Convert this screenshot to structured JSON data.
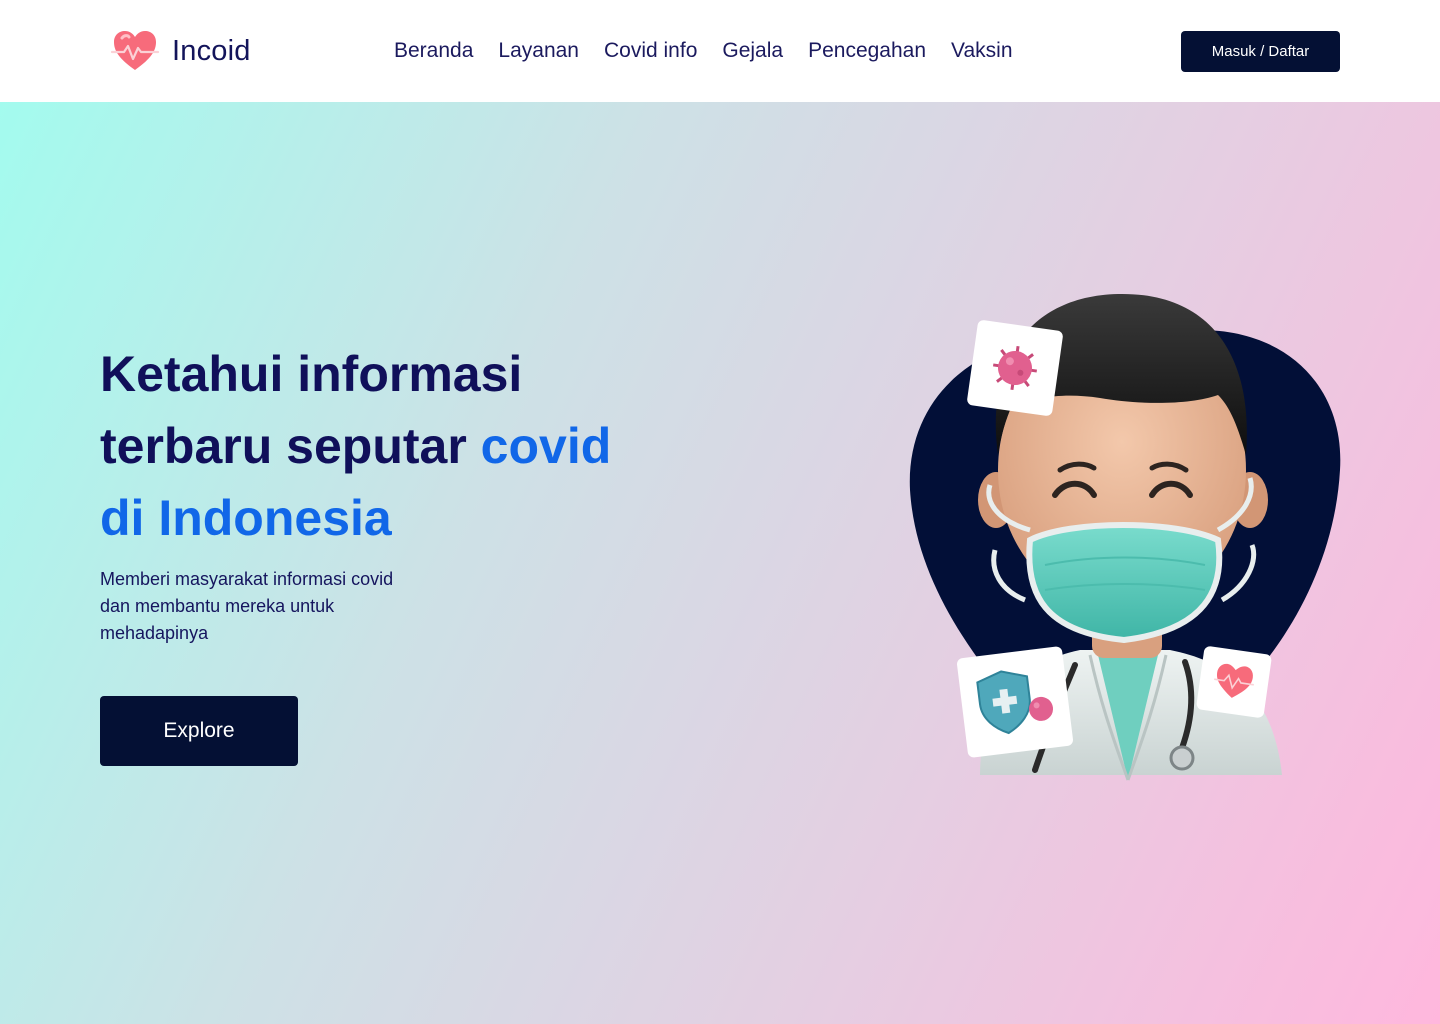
{
  "brand": {
    "name": "Incoid",
    "logo_icon": "heart-pulse-icon",
    "logo_color": "#f76b7b"
  },
  "nav": {
    "links": [
      "Beranda",
      "Layanan",
      "Covid info",
      "Gejala",
      "Pencegahan",
      "Vaksin"
    ],
    "login_label": "Masuk / Daftar"
  },
  "hero": {
    "headline_part1": "Ketahui informasi",
    "headline_part2": "terbaru seputar ",
    "headline_accent1": "covid",
    "headline_accent2": "di Indonesia",
    "subtext": "Memberi masyarakat informasi covid dan membantu mereka untuk mehadapinya",
    "cta_label": "Explore",
    "illustration_icons": [
      "virus-icon",
      "shield-virus-icon",
      "heart-pulse-icon"
    ]
  },
  "colors": {
    "primary_dark": "#041034",
    "headline": "#10105a",
    "accent_blue": "#1167e8",
    "gradient_start": "#a3fbee",
    "gradient_end": "#ffb7dd",
    "mask_teal": "#5ccdbf"
  }
}
